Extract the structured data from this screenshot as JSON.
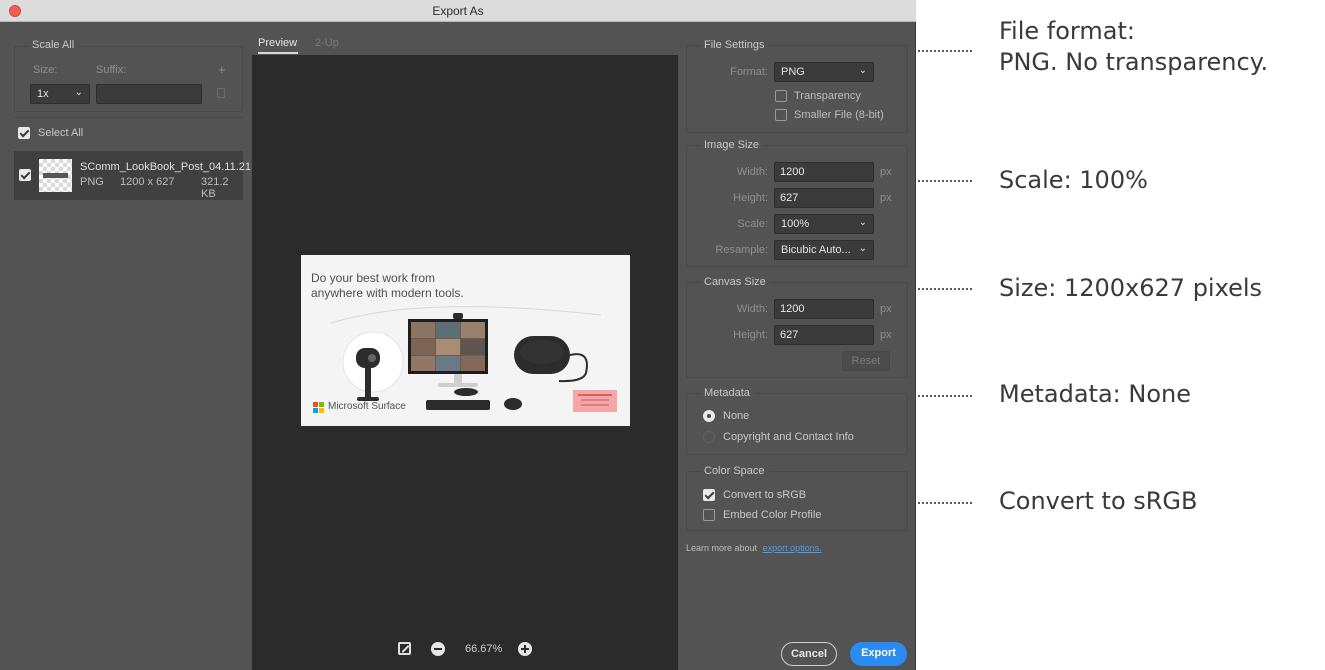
{
  "window": {
    "title": "Export As"
  },
  "left_panel": {
    "scale_all_title": "Scale All",
    "size_label": "Size:",
    "suffix_label": "Suffix:",
    "add_icon": "plus-icon",
    "size_value": "1x",
    "suffix_value": "",
    "select_all_label": "Select All",
    "asset": {
      "name": "SComm_LookBook_Post_04.11.21",
      "format": "PNG",
      "dimensions": "1200 x 627",
      "filesize": "321.2 KB"
    }
  },
  "preview": {
    "tabs": [
      "Preview",
      "2-Up"
    ],
    "ad": {
      "headline_line1": "Do your best work from",
      "headline_line2": "anywhere with modern tools.",
      "brand": "Microsoft Surface"
    },
    "zoom_level": "66.67%"
  },
  "file_settings": {
    "title": "File Settings",
    "format_label": "Format:",
    "format_value": "PNG",
    "transparency_label": "Transparency",
    "transparency_checked": false,
    "smaller_file_label": "Smaller File (8-bit)",
    "smaller_file_checked": false
  },
  "image_size": {
    "title": "Image Size",
    "width_label": "Width:",
    "width_value": "1200",
    "height_label": "Height:",
    "height_value": "627",
    "scale_label": "Scale:",
    "scale_value": "100%",
    "resample_label": "Resample:",
    "resample_value": "Bicubic Auto...",
    "unit": "px"
  },
  "canvas_size": {
    "title": "Canvas Size",
    "width_label": "Width:",
    "width_value": "1200",
    "height_label": "Height:",
    "height_value": "627",
    "unit": "px",
    "reset_label": "Reset"
  },
  "metadata": {
    "title": "Metadata",
    "option_none": "None",
    "option_copyright": "Copyright and Contact Info",
    "selected": "None"
  },
  "color_space": {
    "title": "Color Space",
    "convert_label": "Convert to sRGB",
    "convert_checked": true,
    "embed_label": "Embed Color Profile",
    "embed_checked": false
  },
  "learn_more": {
    "prefix": "Learn more about",
    "link": "export options."
  },
  "buttons": {
    "cancel": "Cancel",
    "export": "Export"
  },
  "colors": {
    "accent": "#2a8cf0",
    "panel": "#535353",
    "canvas": "#2b2b2b"
  },
  "annotations": [
    {
      "line1": "File format:",
      "line2": "PNG. No transparency."
    },
    {
      "line1": "Scale: 100%"
    },
    {
      "line1": "Size: 1200x627 pixels"
    },
    {
      "line1": "Metadata: None"
    },
    {
      "line1": "Convert to sRGB"
    }
  ]
}
